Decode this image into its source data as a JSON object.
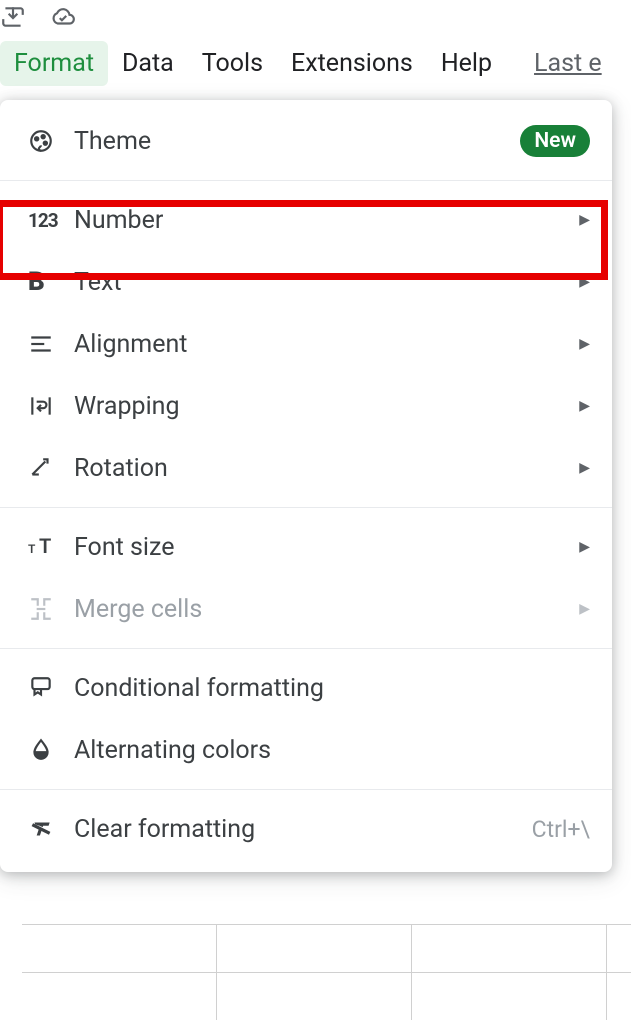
{
  "menubar": {
    "format": "Format",
    "data": "Data",
    "tools": "Tools",
    "extensions": "Extensions",
    "help": "Help",
    "last_edit": "Last e"
  },
  "menu": {
    "theme": "Theme",
    "theme_badge": "New",
    "number": "Number",
    "text": "Text",
    "alignment": "Alignment",
    "wrapping": "Wrapping",
    "rotation": "Rotation",
    "font_size": "Font size",
    "merge_cells": "Merge cells",
    "conditional_formatting": "Conditional formatting",
    "alternating_colors": "Alternating colors",
    "clear_formatting": "Clear formatting",
    "clear_formatting_shortcut": "Ctrl+\\"
  }
}
